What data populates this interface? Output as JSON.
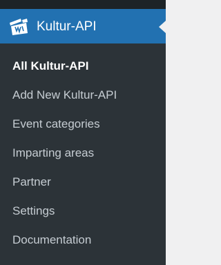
{
  "menu": {
    "title": "Kultur-API",
    "icon": "kultur-api-plugin-icon",
    "items": [
      {
        "label": "All Kultur-API",
        "current": true
      },
      {
        "label": "Add New Kultur-API"
      },
      {
        "label": "Event categories"
      },
      {
        "label": "Imparting areas"
      },
      {
        "label": "Partner"
      },
      {
        "label": "Settings"
      },
      {
        "label": "Documentation"
      }
    ]
  },
  "colors": {
    "sidebar_bg": "#2c3338",
    "active_menu_bg": "#2271b1",
    "text_current": "#ffffff",
    "text_default": "#c3c4c7"
  }
}
